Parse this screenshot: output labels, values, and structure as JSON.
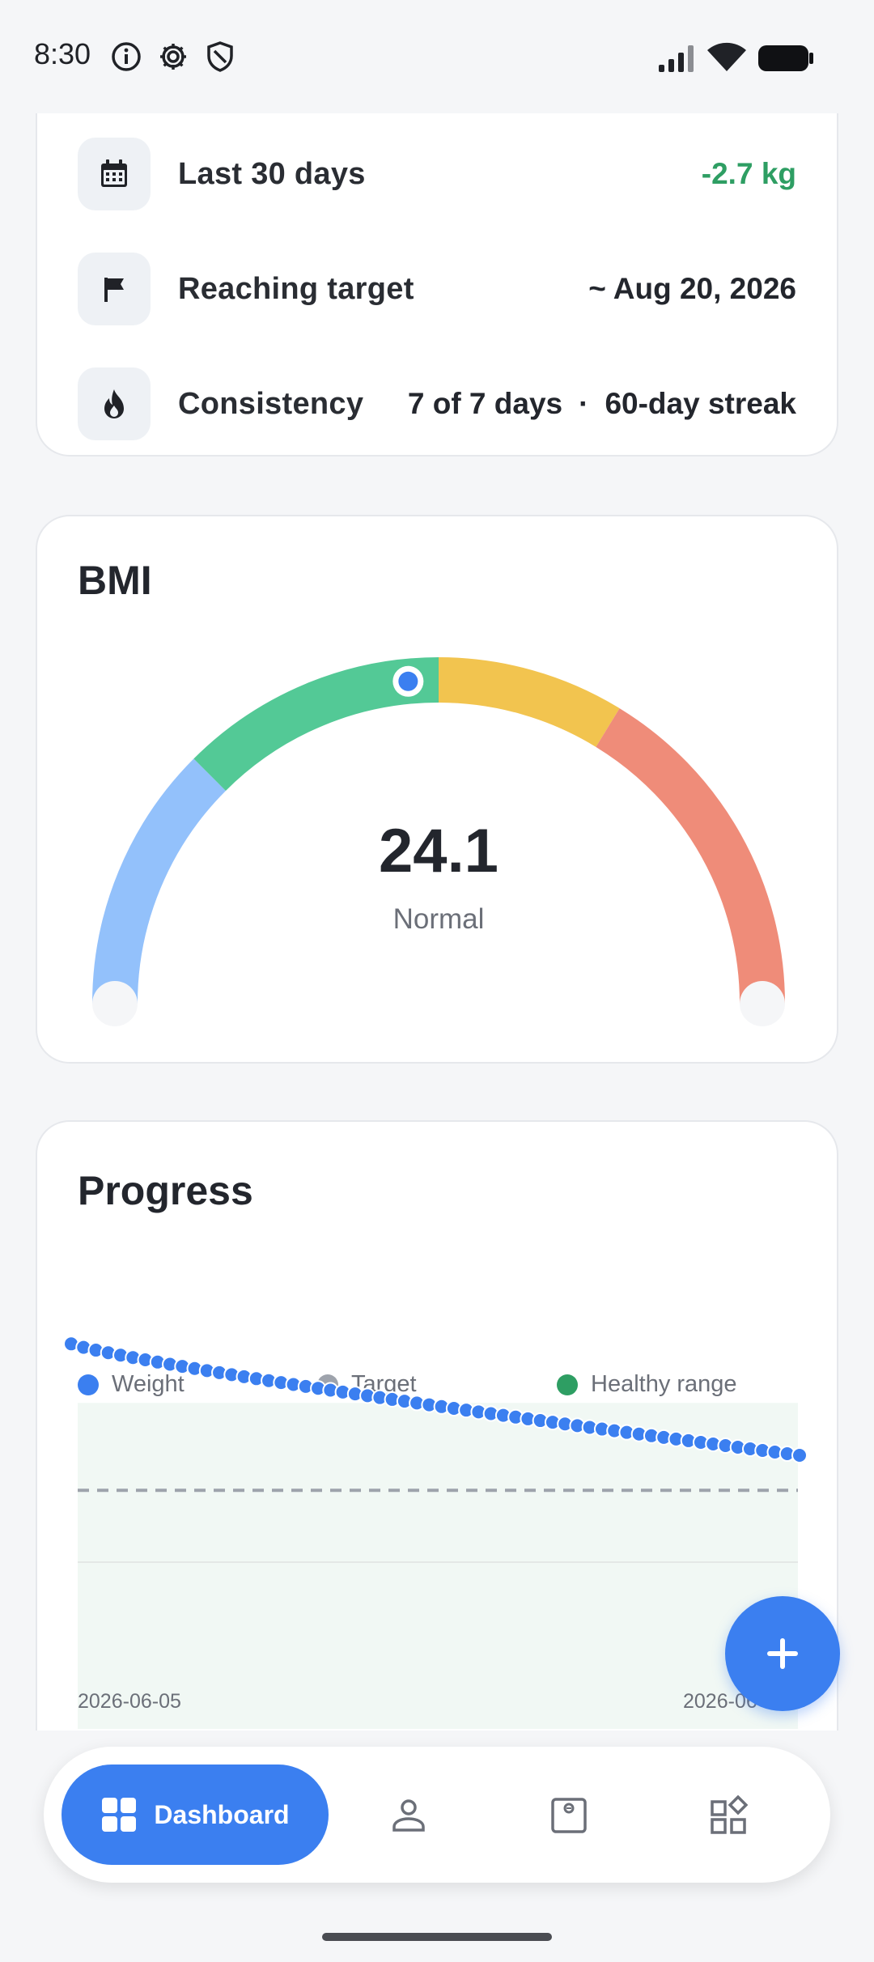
{
  "status_bar": {
    "time": "8:30",
    "icons": [
      "info-icon",
      "gear-icon",
      "shield-icon",
      "signal-icon",
      "wifi-icon",
      "battery-icon"
    ]
  },
  "stats": {
    "rows": [
      {
        "icon": "calendar-icon",
        "label": "Last 30 days",
        "value": "-2.7 kg",
        "value_color": "#2e9e63"
      },
      {
        "icon": "flag-icon",
        "label": "Reaching target",
        "value": "~ Aug 20, 2026"
      },
      {
        "icon": "flame-icon",
        "label": "Consistency",
        "value_part1": "7 of 7 days",
        "separator": "·",
        "value_part2": "60-day streak"
      }
    ]
  },
  "bmi": {
    "title": "BMI",
    "value": "24.1",
    "category": "Normal",
    "gauge_fraction": 0.47,
    "segment_colors": [
      "#93c1fb",
      "#53c996",
      "#f2c44f",
      "#ef8c79"
    ]
  },
  "progress": {
    "title": "Progress",
    "legend": [
      {
        "label": "Weight",
        "color": "#3b7ff0"
      },
      {
        "label": "Target",
        "color": "#9ea3ac"
      },
      {
        "label": "Healthy range",
        "color": "#2e9e63"
      }
    ],
    "x_start_label": "2026-06-05",
    "x_end_label": "2026-06",
    "chart_data": {
      "type": "scatter",
      "series": [
        {
          "name": "Weight",
          "color": "#3b7ff0",
          "start_level": 0.955,
          "end_level": 0.7,
          "points": 60
        },
        {
          "name": "Target",
          "color": "#9ea3ac",
          "level": 0.62
        },
        {
          "name": "Healthy range",
          "color": "#2e9e63",
          "band": [
            0.0,
            0.82
          ]
        }
      ]
    }
  },
  "fab": {
    "icon": "plus-icon"
  },
  "bottom_nav": {
    "active_label": "Dashboard",
    "items": [
      "dashboard-icon",
      "person-icon",
      "scale-icon",
      "widgets-icon"
    ]
  }
}
